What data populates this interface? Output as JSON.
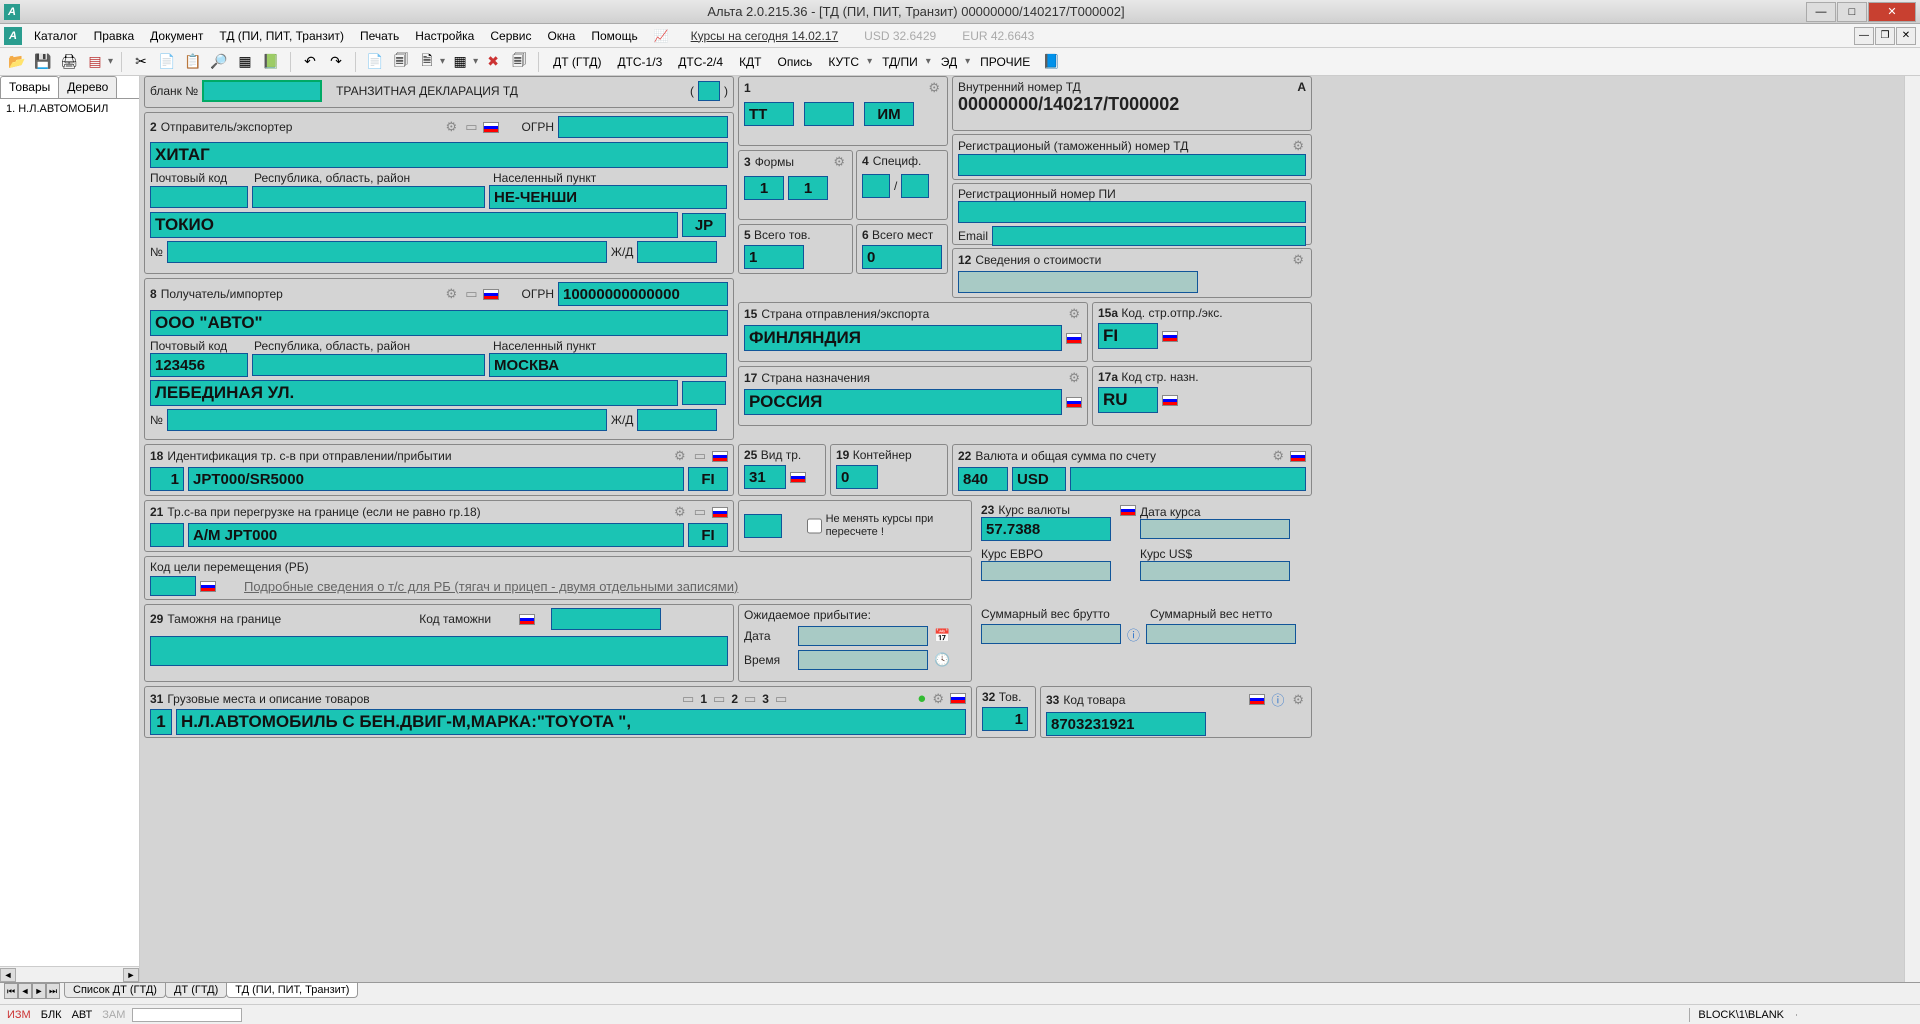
{
  "window": {
    "title": "Альта 2.0.215.36 - [ТД (ПИ, ПИТ, Транзит) 00000000/140217/T000002]"
  },
  "menu": {
    "items": [
      "Каталог",
      "Правка",
      "Документ",
      "ТД (ПИ, ПИТ, Транзит)",
      "Печать",
      "Настройка",
      "Сервис",
      "Окна",
      "Помощь"
    ],
    "rates_label": "Курсы на сегодня 14.02.17",
    "rates_usd": "USD 32.6429",
    "rates_eur": "EUR 42.6643"
  },
  "toolbar2": {
    "items": [
      "ДТ (ГТД)",
      "ДТС-1/3",
      "ДТС-2/4",
      "КДТ",
      "Опись",
      "КУТС",
      "ТД/ПИ",
      "ЭД",
      "ПРОЧИЕ"
    ]
  },
  "side": {
    "tab1": "Товары",
    "tab2": "Дерево",
    "item1": "1. Н.Л.АВТОМОБИЛ"
  },
  "form": {
    "blank_no": "бланк №",
    "header": "ТРАНЗИТНАЯ ДЕКЛАРАЦИЯ   ТД",
    "b1_val": "1",
    "b1_tt": "ТТ",
    "b1_im": "ИМ",
    "b2_label": "Отправитель/экспортер",
    "ogrn": "ОГРН",
    "b2_name": "ХИТАГ",
    "postal": "Почтовый код",
    "region": "Республика, область, район",
    "city": "Населенный пункт",
    "b2_city": "НЕ-ЧЕНШИ",
    "b2_city2": "ТОКИО",
    "b2_cc": "JP",
    "noo": "№",
    "zhd": "Ж/Д",
    "b3_label": "Формы",
    "b3_v1": "1",
    "b3_v2": "1",
    "b4_label": "Специф.",
    "b4_slash": "/",
    "b5_label": "Всего тов.",
    "b5_v": "1",
    "b6_label": "Всего мест",
    "b6_v": "0",
    "b8_label": "Получатель/импортер",
    "b8_ogrn_v": "10000000000000",
    "b8_name": "ООО \"АВТО\"",
    "b8_postal": "123456",
    "b8_city": "МОСКВА",
    "b8_street": "ЛЕБЕДИНАЯ УЛ.",
    "inner_label": "Внутренний номер ТД",
    "inner_value": "00000000/140217/T000002",
    "reg_label": "Регистрационый (таможенный) номер ТД",
    "reg_pi_label": "Регистрационный номер ПИ",
    "email": "Email",
    "b12_label": "Сведения о стоимости",
    "b15_label": "Страна отправления/экспорта",
    "b15_v": "ФИНЛЯНДИЯ",
    "b15a_label": "Код. стр.отпр./экс.",
    "b15a_v": "FI",
    "b17_label": "Страна назначения",
    "b17_v": "РОССИЯ",
    "b17a_label": "Код стр. назн.",
    "b17a_v": "RU",
    "b18_label": "Идентификация тр. с-в при отправлении/прибытии",
    "b18_n": "1",
    "b18_v": "JPT000/SR5000",
    "b18_cc": "FI",
    "b21_label": "Тр.с-ва при перегрузке на границе (если не равно гр.18)",
    "b21_v": "А/М JPT000",
    "b21_cc": "FI",
    "b25_label": "Вид тр.",
    "b25_v": "31",
    "b19_label": "Контейнер",
    "b19_v": "0",
    "b22_label": "Валюта и общая сумма по счету",
    "b22_code": "840",
    "b22_cur": "USD",
    "norate": "Не менять курсы при пересчете !",
    "b23_label": "Курс валюты",
    "b23_v": "57.7388",
    "rate_date": "Дата курса",
    "rate_eur": "Курс ЕВРО",
    "rate_usd": "Курс US$",
    "brb_label": "Код цели перемещения (РБ)",
    "brb_link": "Подробные сведения о т/с для РБ (тягач и прицеп - двумя отдельными записями)",
    "b29_label": "Таможня на границе",
    "b29_code": "Код таможни",
    "arr_label": "Ожидаемое прибытие:",
    "arr_date": "Дата",
    "arr_time": "Время",
    "gross_label": "Суммарный вес брутто",
    "net_label": "Суммарный вес нетто",
    "b31_label": "Грузовые места и описание товаров",
    "b31_1": "1",
    "b31_2": "2",
    "b31_3": "3",
    "b31_n": "1",
    "b31_v": "Н.Л.АВТОМОБИЛЬ С БЕН.ДВИГ-М,МАРКА:\"TOYOTA \",",
    "b32_label": "Тов.",
    "b32_v": "1",
    "b33_label": "Код товара",
    "b33_v": "8703231921",
    "letterA": "A"
  },
  "btabs": {
    "t1": "Список ДТ (ГТД)",
    "t2": "ДТ (ГТД)",
    "t3": "ТД (ПИ, ПИТ, Транзит)"
  },
  "status": {
    "izm": "ИЗМ",
    "blk": "БЛК",
    "avt": "АВТ",
    "zam": "ЗАМ",
    "block": "BLOCK\\1\\BLANK"
  }
}
